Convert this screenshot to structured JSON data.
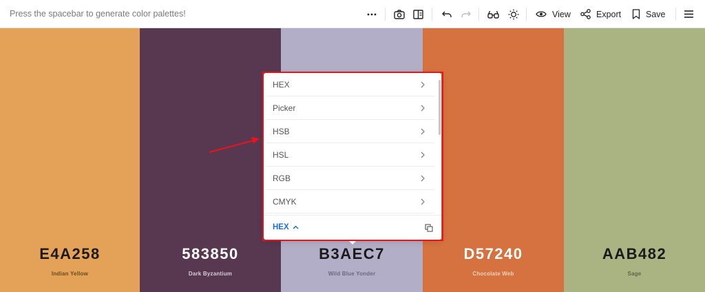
{
  "topbar": {
    "hint": "Press the spacebar to generate color palettes!",
    "more_icon": "more-horizontal-icon",
    "camera_icon": "camera-icon",
    "layout_icon": "layout-icon",
    "undo_icon": "undo-icon",
    "redo_icon": "redo-icon",
    "glasses_icon": "glasses-icon",
    "brightness_icon": "brightness-icon",
    "view_label": "View",
    "export_label": "Export",
    "save_label": "Save",
    "menu_icon": "hamburger-menu-icon"
  },
  "palette": [
    {
      "hex": "E4A258",
      "name": "Indian Yellow",
      "color": "#E4A258",
      "text_color": "#1a1a1a",
      "sub_color": "#6b4a1f"
    },
    {
      "hex": "583850",
      "name": "Dark Byzantium",
      "color": "#583850",
      "text_color": "#ffffff",
      "sub_color": "#d9cbd5"
    },
    {
      "hex": "B3AEC7",
      "name": "Wild Blue Yonder",
      "color": "#B3AEC7",
      "text_color": "#1a1a1a",
      "sub_color": "#6d6880"
    },
    {
      "hex": "D57240",
      "name": "Chocolate Web",
      "color": "#D57240",
      "text_color": "#ffffff",
      "sub_color": "#f6d3bf"
    },
    {
      "hex": "AAB482",
      "name": "Sage",
      "color": "#AAB482",
      "text_color": "#1a1a1a",
      "sub_color": "#5f6641"
    }
  ],
  "dropdown": {
    "items": [
      "HEX",
      "Picker",
      "HSB",
      "HSL",
      "RGB",
      "CMYK"
    ],
    "mode_label": "HEX",
    "copy_icon": "copy-icon"
  },
  "colors": {
    "accent": "#1b6fe0",
    "annotation": "#e8141b"
  }
}
